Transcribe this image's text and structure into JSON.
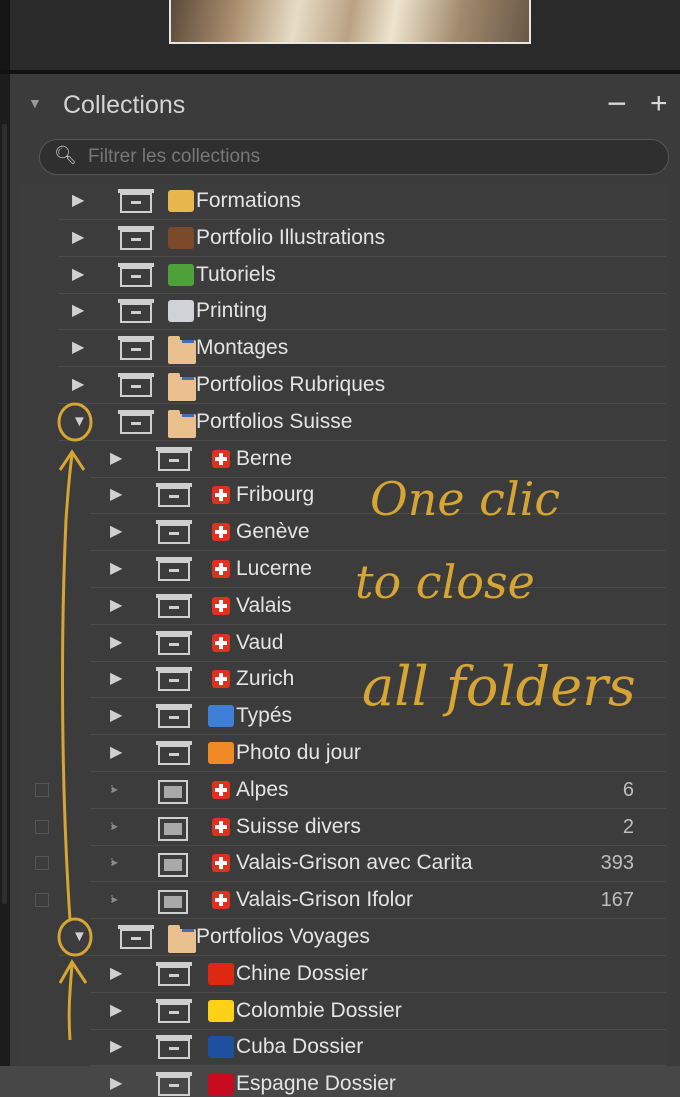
{
  "panel": {
    "title": "Collections",
    "minus_label": "−",
    "plus_label": "+",
    "search_placeholder": "Filtrer les collections"
  },
  "rows": [
    {
      "label": "Formations",
      "kind": "set",
      "icon": "teacher-emoji-icon"
    },
    {
      "label": "Portfolio Illustrations",
      "kind": "set",
      "icon": "briefcase-emoji-icon"
    },
    {
      "label": "Tutoriels",
      "kind": "set",
      "icon": "green-book-icon"
    },
    {
      "label": "Printing",
      "kind": "set",
      "icon": "printer-icon"
    },
    {
      "label": "Montages",
      "kind": "set",
      "icon": "folder-icon"
    },
    {
      "label": "Portfolios Rubriques",
      "kind": "set",
      "icon": "folder-icon"
    },
    {
      "label": "Portfolios Suisse",
      "kind": "set",
      "icon": "folder-icon",
      "expanded": true
    },
    {
      "label": "Berne",
      "kind": "set",
      "icon": "swiss-flag-icon"
    },
    {
      "label": "Fribourg",
      "kind": "set",
      "icon": "swiss-flag-icon"
    },
    {
      "label": "Genève",
      "kind": "set",
      "icon": "swiss-flag-icon"
    },
    {
      "label": "Lucerne",
      "kind": "set",
      "icon": "swiss-flag-icon"
    },
    {
      "label": "Valais",
      "kind": "set",
      "icon": "swiss-flag-icon"
    },
    {
      "label": "Vaud",
      "kind": "set",
      "icon": "swiss-flag-icon"
    },
    {
      "label": "Zurich",
      "kind": "set",
      "icon": "swiss-flag-icon"
    },
    {
      "label": "Typés",
      "kind": "set",
      "icon": "blue-book-icon"
    },
    {
      "label": "Photo du jour",
      "kind": "set",
      "icon": "orange-book-icon"
    },
    {
      "label": "Alpes",
      "kind": "smart",
      "icon": "swiss-flag-icon",
      "count": "6"
    },
    {
      "label": "Suisse divers",
      "kind": "smart",
      "icon": "swiss-flag-icon",
      "count": "2"
    },
    {
      "label": "Valais-Grison avec Carita",
      "kind": "smart",
      "icon": "swiss-flag-icon",
      "count": "393"
    },
    {
      "label": "Valais-Grison Ifolor",
      "kind": "smart",
      "icon": "swiss-flag-icon",
      "count": "167"
    },
    {
      "label": "Portfolios Voyages",
      "kind": "set",
      "icon": "folder-icon",
      "expanded": true
    },
    {
      "label": "Chine Dossier",
      "kind": "set",
      "icon": "china-flag-icon"
    },
    {
      "label": "Colombie Dossier",
      "kind": "set",
      "icon": "colombia-flag-icon"
    },
    {
      "label": "Cuba Dossier",
      "kind": "set",
      "icon": "cuba-flag-icon"
    },
    {
      "label": "Espagne Dossier",
      "kind": "set",
      "icon": "spain-flag-icon"
    }
  ],
  "annotation": {
    "line1": "One clic",
    "line2": "to close",
    "line3": "all folders"
  },
  "colors": {
    "annotation": "#d6a533",
    "panel_bg": "#3b3b3b"
  }
}
